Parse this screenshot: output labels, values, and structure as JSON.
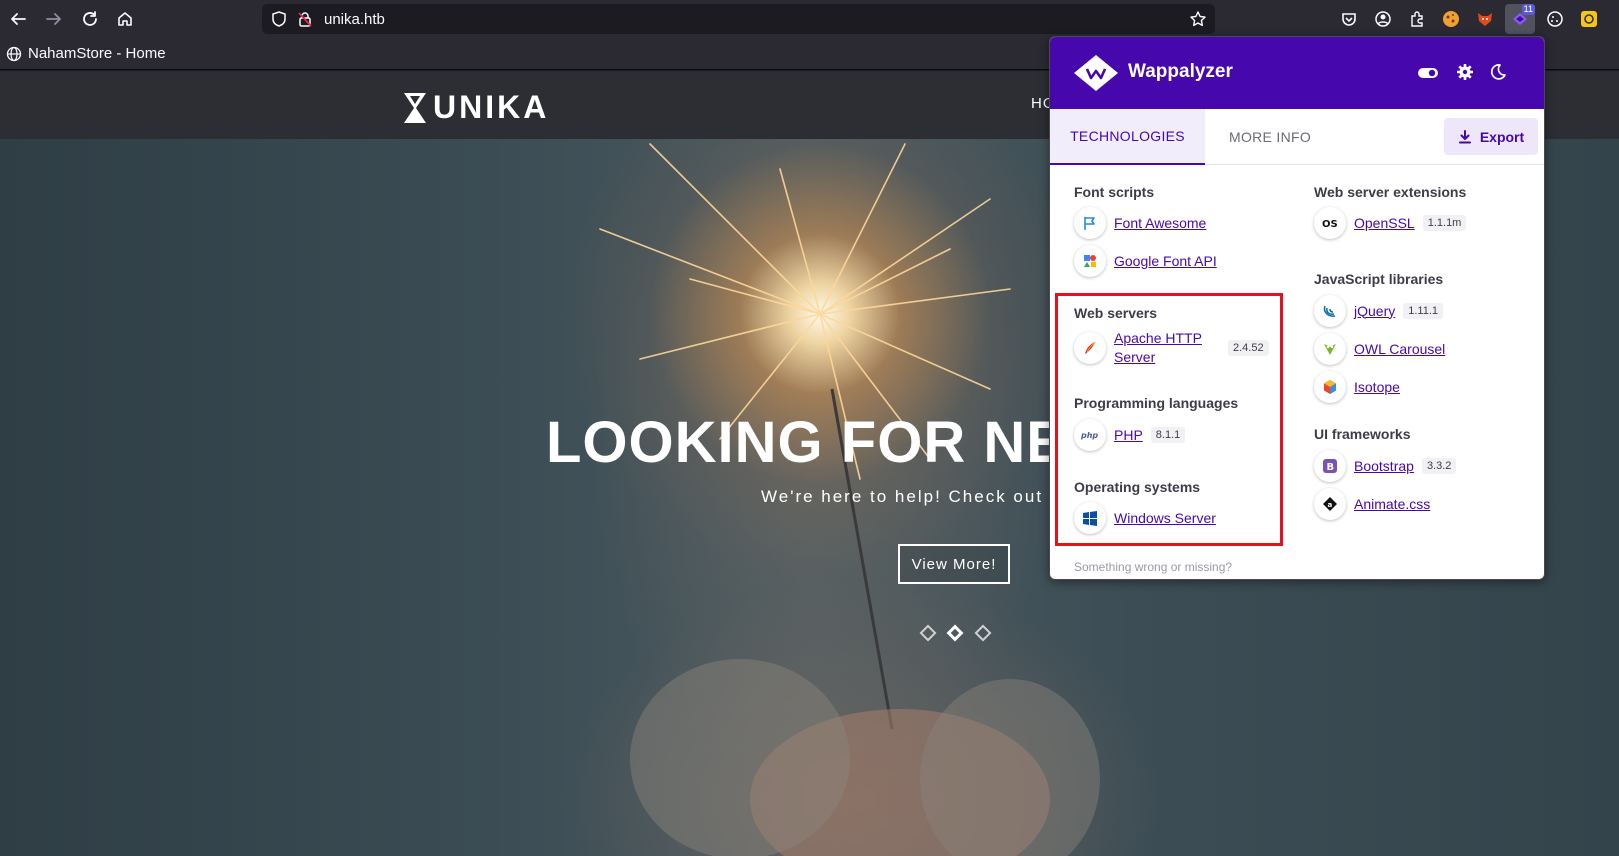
{
  "browser": {
    "url": "unika.htb",
    "tab_title": "NahamStore - Home",
    "extension_badge": "11"
  },
  "site": {
    "logo_text": "UNIKA",
    "nav_home": "HO",
    "hero_title": "LOOKING FOR NEW",
    "hero_subtitle": "We're here to help! Check out ou",
    "cta_label": "View More!",
    "slide_count": 3,
    "active_slide": 2
  },
  "wappalyzer": {
    "title": "Wappalyzer",
    "tabs": {
      "technologies": "TECHNOLOGIES",
      "more_info": "MORE INFO"
    },
    "export_label": "Export",
    "categories": {
      "font_scripts": {
        "name": "Font scripts",
        "items": [
          {
            "name": "Font Awesome",
            "version": ""
          },
          {
            "name": "Google Font API",
            "version": ""
          }
        ]
      },
      "web_servers": {
        "name": "Web servers",
        "items": [
          {
            "name_line1": "Apache HTTP",
            "name_line2": "Server",
            "version": "2.4.52"
          }
        ]
      },
      "programming_languages": {
        "name": "Programming languages",
        "items": [
          {
            "name": "PHP",
            "version": "8.1.1"
          }
        ]
      },
      "operating_systems": {
        "name": "Operating systems",
        "items": [
          {
            "name": "Windows Server",
            "version": ""
          }
        ]
      },
      "web_server_extensions": {
        "name": "Web server extensions",
        "items": [
          {
            "name": "OpenSSL",
            "version": "1.1.1m"
          }
        ]
      },
      "javascript_libraries": {
        "name": "JavaScript libraries",
        "items": [
          {
            "name": "jQuery",
            "version": "1.11.1"
          },
          {
            "name": "OWL Carousel",
            "version": ""
          },
          {
            "name": "Isotope",
            "version": ""
          }
        ]
      },
      "ui_frameworks": {
        "name": "UI frameworks",
        "items": [
          {
            "name": "Bootstrap",
            "version": "3.3.2"
          },
          {
            "name": "Animate.css",
            "version": ""
          }
        ]
      }
    },
    "footer_hint": "Something wrong or missing?"
  }
}
